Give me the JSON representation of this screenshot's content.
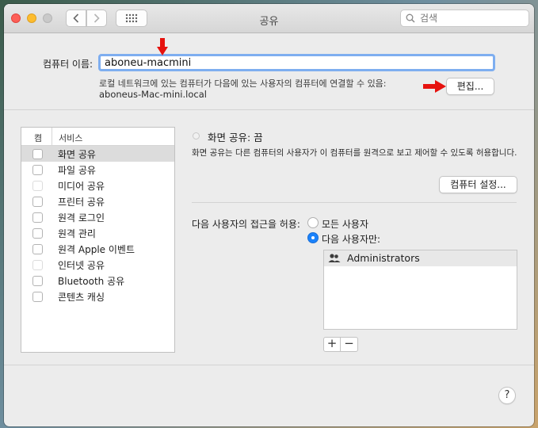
{
  "window": {
    "title": "공유",
    "search_placeholder": "검색"
  },
  "computer_name": {
    "label": "컴퓨터 이름:",
    "value": "aboneu-macmini",
    "description": "로컬 네트워크에 있는 컴퓨터가 다음에 있는 사용자의 컴퓨터에 연결할 수 있음:",
    "local_host": "aboneus-Mac-mini.local",
    "edit_button": "편집..."
  },
  "services": {
    "header_on": "켬",
    "header_service": "서비스",
    "items": [
      {
        "label": "화면 공유",
        "checked": false,
        "selected": true,
        "enabled": true
      },
      {
        "label": "파일 공유",
        "checked": false,
        "selected": false,
        "enabled": true
      },
      {
        "label": "미디어 공유",
        "checked": false,
        "selected": false,
        "enabled": false
      },
      {
        "label": "프린터 공유",
        "checked": false,
        "selected": false,
        "enabled": true
      },
      {
        "label": "원격 로그인",
        "checked": false,
        "selected": false,
        "enabled": true
      },
      {
        "label": "원격 관리",
        "checked": false,
        "selected": false,
        "enabled": true
      },
      {
        "label": "원격 Apple 이벤트",
        "checked": false,
        "selected": false,
        "enabled": true
      },
      {
        "label": "인터넷 공유",
        "checked": false,
        "selected": false,
        "enabled": false
      },
      {
        "label": "Bluetooth 공유",
        "checked": false,
        "selected": false,
        "enabled": true
      },
      {
        "label": "콘텐츠 캐싱",
        "checked": false,
        "selected": false,
        "enabled": true
      }
    ]
  },
  "detail": {
    "status": "화면 공유: 끔",
    "description": "화면 공유는 다른 컴퓨터의 사용자가 이 컴퓨터를 원격으로 보고 제어할 수 있도록 허용합니다.",
    "settings_button": "컴퓨터 설정...",
    "access_label": "다음 사용자의 접근을 허용:",
    "option_all": "모든 사용자",
    "option_only": "다음 사용자만:",
    "selected_option": "option_only",
    "users": [
      "Administrators"
    ],
    "add_button": "+",
    "remove_button": "−"
  },
  "help_button": "?",
  "colors": {
    "accent": "#1a82fb",
    "annotation_arrow": "#e6120e"
  }
}
